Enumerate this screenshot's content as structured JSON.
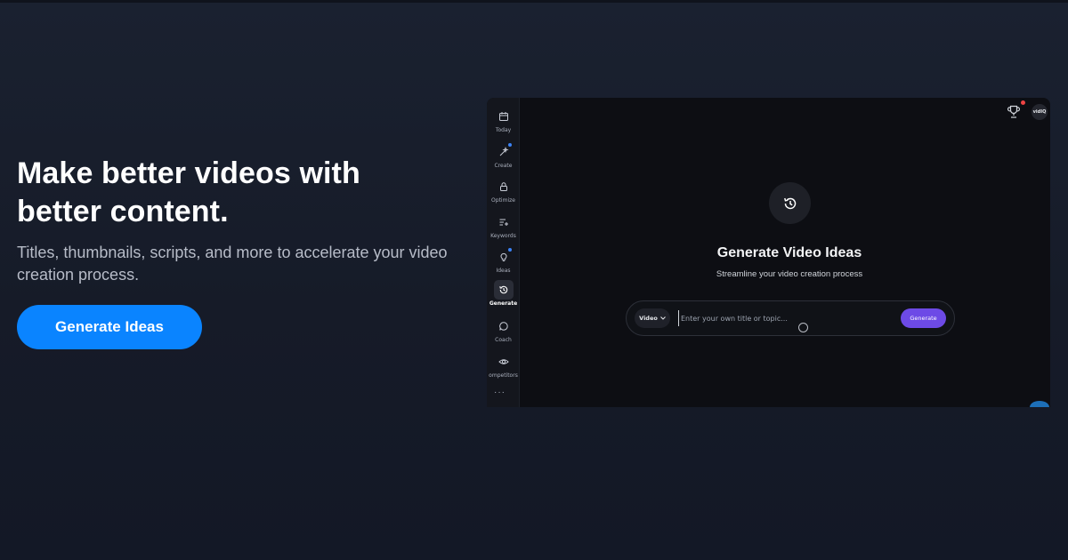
{
  "hero": {
    "title_line1": "Make better videos with",
    "title_line2": "better content.",
    "subtitle_line1": "Titles, thumbnails, scripts, and more to accelerate your video",
    "subtitle_line2": "creation process.",
    "cta_label": "Generate Ideas"
  },
  "app": {
    "sidebar": [
      {
        "label": "Today",
        "icon": "calendar-icon"
      },
      {
        "label": "Create",
        "icon": "magic-wand-icon",
        "dot": true
      },
      {
        "label": "Optimize",
        "icon": "lock-icon"
      },
      {
        "label": "Keywords",
        "icon": "list-plus-icon"
      },
      {
        "label": "Ideas",
        "icon": "lightbulb-icon",
        "dot": true
      },
      {
        "label": "Generate",
        "icon": "history-icon",
        "active": true
      },
      {
        "label": "Coach",
        "icon": "chat-bubble-icon"
      },
      {
        "label": "ompetitors",
        "icon": "eye-icon"
      }
    ],
    "more_label": "···",
    "avatar_text": "vidIQ",
    "heading": "Generate Video Ideas",
    "subheading": "Streamline your video creation process",
    "format_select": "Video",
    "topic_placeholder": "Enter your own title or topic...",
    "generate_label": "Generate"
  },
  "colors": {
    "accent_blue": "#0a84ff",
    "generate_purple": "#6d4ae6",
    "notification_red": "#ef4444"
  }
}
